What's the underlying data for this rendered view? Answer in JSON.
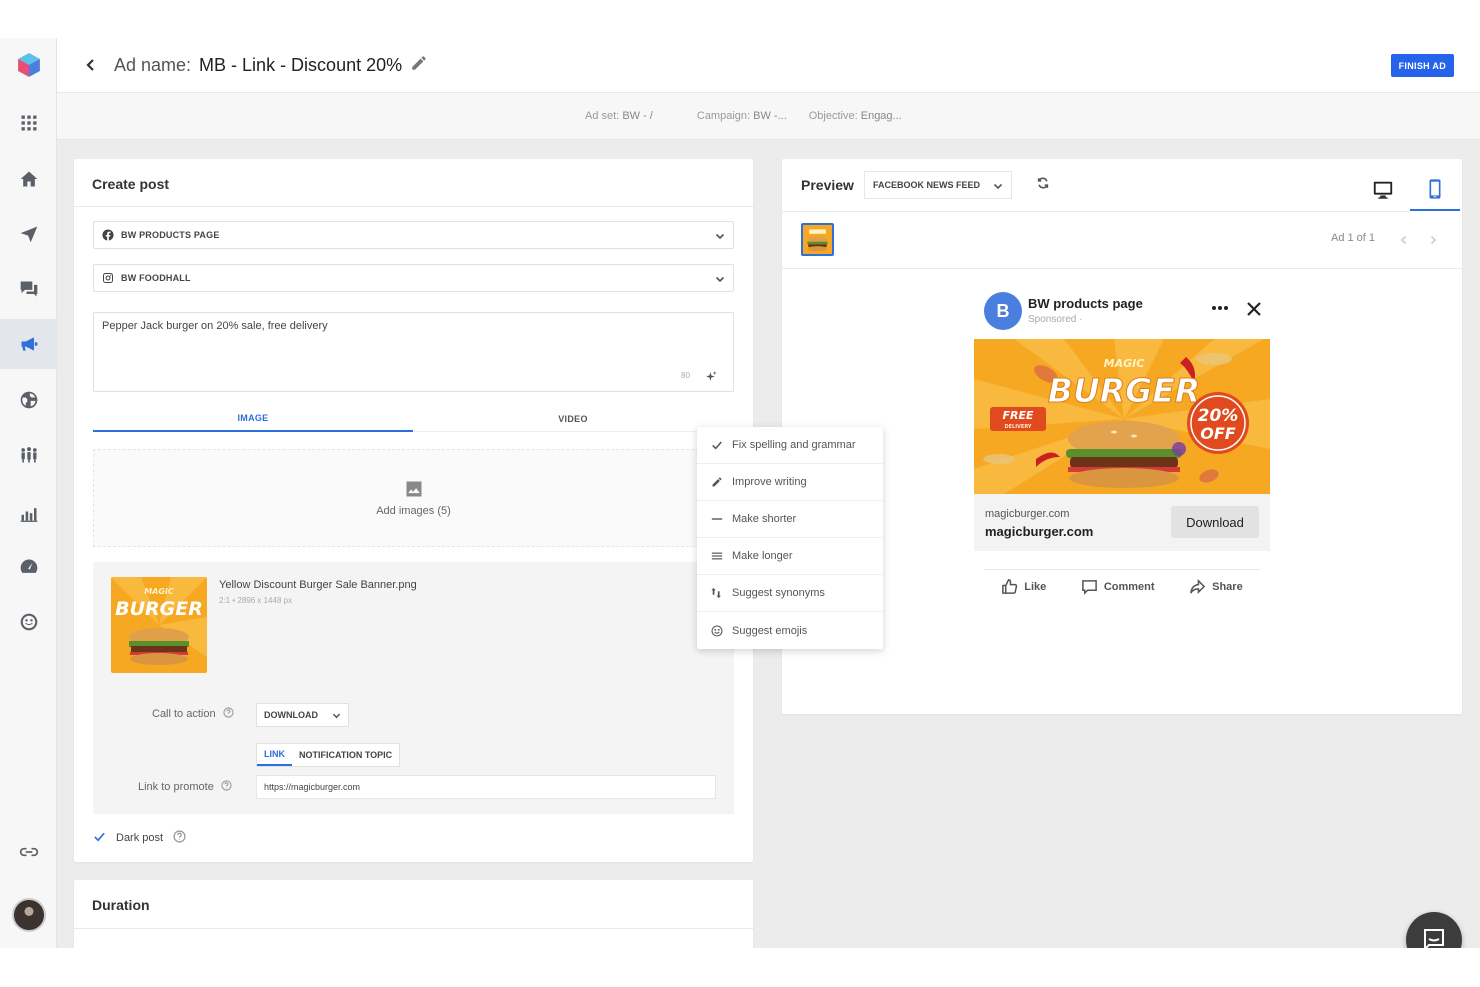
{
  "header": {
    "ad_name_label": "Ad name:",
    "ad_name": "MB - Link - Discount 20%",
    "finish_label": "FINISH AD"
  },
  "subheader": {
    "ad_set_label": "Ad set:",
    "ad_set_value": "BW -  /",
    "campaign_label": "Campaign:",
    "campaign_value": "BW -...",
    "objective_label": "Objective:",
    "objective_value": "Engag..."
  },
  "create_post": {
    "title": "Create post",
    "facebook_page": "BW PRODUCTS PAGE",
    "instagram_account": "BW FOODHALL",
    "message": "Pepper Jack burger on 20% sale, free delivery",
    "char_count": "80",
    "tabs": [
      {
        "label": "IMAGE",
        "active": true
      },
      {
        "label": "VIDEO",
        "active": false
      }
    ],
    "add_images_label": "Add images (5)",
    "media": {
      "file_name": "Yellow Discount Burger Sale Banner.png",
      "file_meta": "2:1 • 2896 x 1448 px"
    },
    "cta_label": "Call to action",
    "cta_value": "DOWNLOAD",
    "link_tabs": [
      {
        "label": "LINK",
        "active": true
      },
      {
        "label": "NOTIFICATION TOPIC",
        "active": false
      }
    ],
    "link_label": "Link to promote",
    "link_value": "https://magicburger.com",
    "dark_post_label": "Dark post"
  },
  "ai_menu": {
    "items": [
      {
        "label": "Fix spelling and grammar",
        "icon": "check-icon"
      },
      {
        "label": "Improve writing",
        "icon": "pencil-icon"
      },
      {
        "label": "Make shorter",
        "icon": "minus-icon"
      },
      {
        "label": "Make longer",
        "icon": "lines-icon"
      },
      {
        "label": "Suggest synonyms",
        "icon": "swap-icon"
      },
      {
        "label": "Suggest emojis",
        "icon": "smiley-icon"
      }
    ]
  },
  "duration": {
    "title": "Duration"
  },
  "preview": {
    "title": "Preview",
    "placement": "FACEBOOK NEWS FEED",
    "ad_count": "Ad 1 of 1",
    "post": {
      "avatar_letter": "B",
      "page_name": "BW products page",
      "sponsored": "Sponsored ·",
      "banner_magic": "MAGIC",
      "banner_burger": "BURGER",
      "banner_discount_top": "20%",
      "banner_discount_bottom": "OFF",
      "banner_free": "FREE",
      "banner_delivery": "DELIVERY",
      "domain_small": "magicburger.com",
      "domain": "magicburger.com",
      "cta": "Download",
      "actions": [
        "Like",
        "Comment",
        "Share"
      ]
    }
  },
  "thumb": {
    "magic": "MAGIC",
    "burger": "BURGER"
  },
  "colors": {
    "accent": "#2f6fd9",
    "finish_button": "#2563eb",
    "banner_orange": "#f7a823"
  }
}
